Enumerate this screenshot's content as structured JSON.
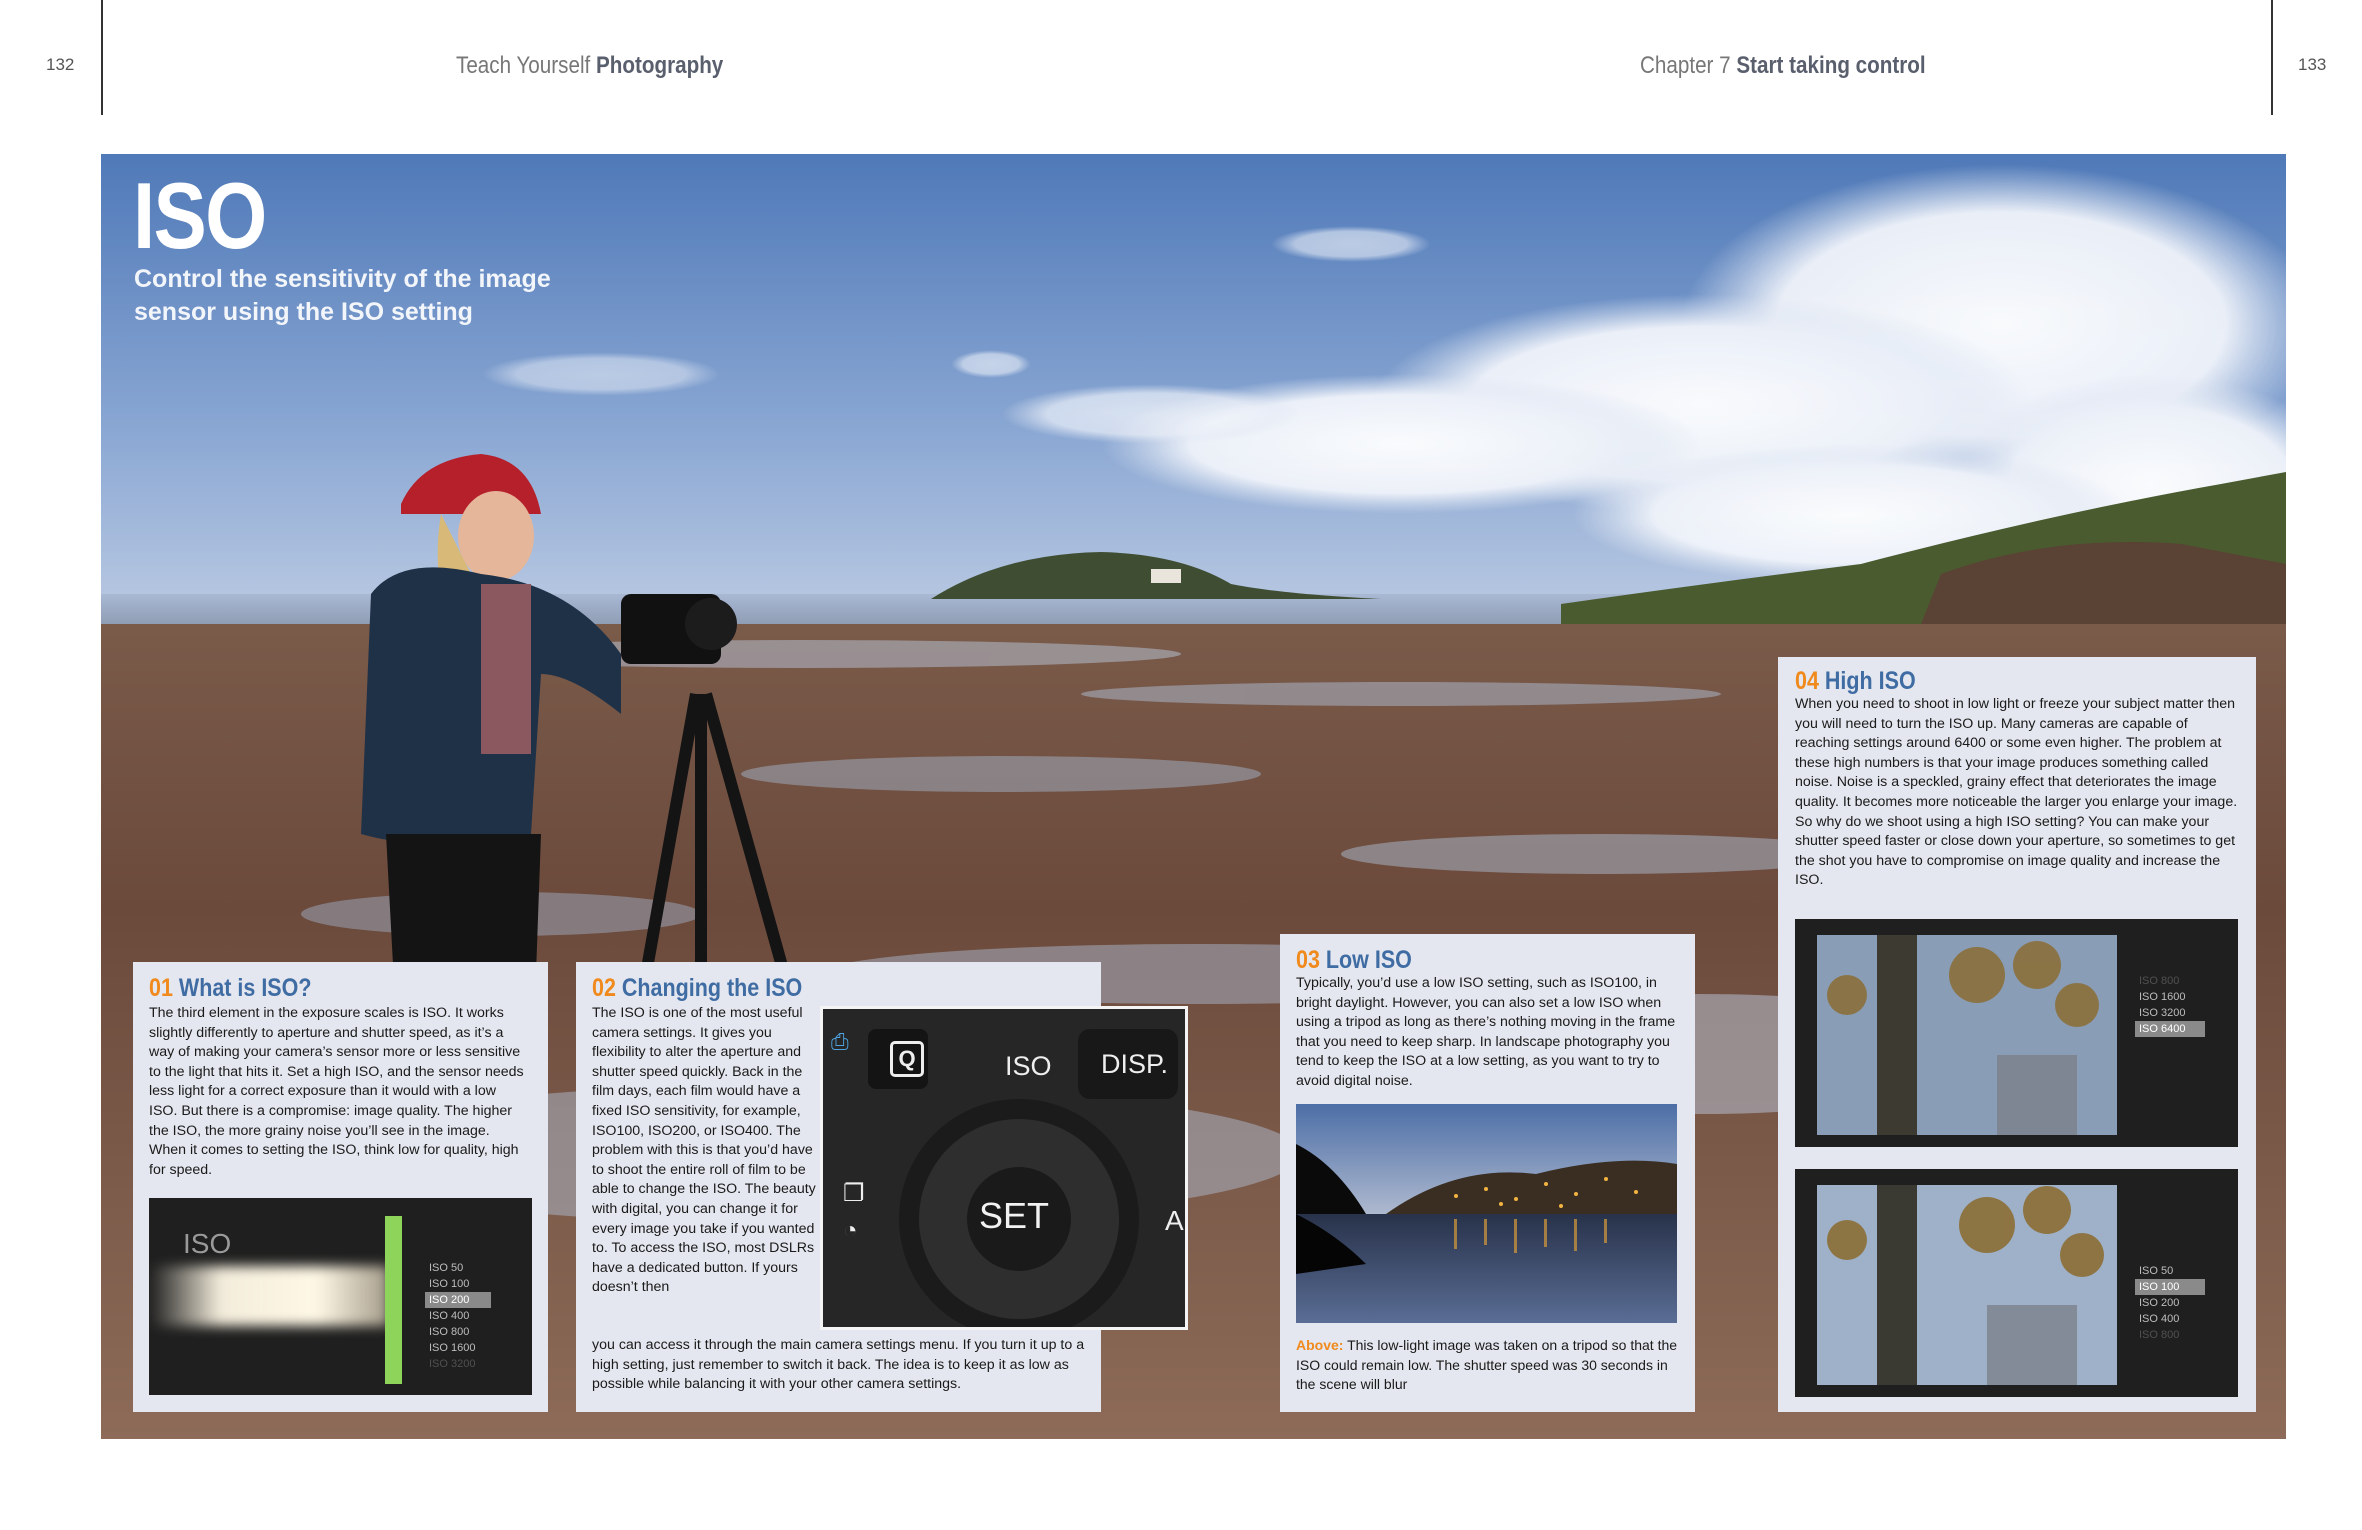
{
  "header": {
    "left_page_number": "132",
    "left_running_light": "Teach Yourself",
    "left_running_bold": "Photography",
    "right_running_light": "Chapter 7",
    "right_running_bold": "Start taking control",
    "right_page_number": "133"
  },
  "hero": {
    "title": "ISO",
    "subtitle": "Control the sensitivity of the image sensor using the ISO setting"
  },
  "sections": [
    {
      "number": "01",
      "heading": "What is ISO?",
      "body": "The third element in the exposure scales is ISO. It works slightly differently to aperture and shutter speed, as it’s a way of making your camera’s sensor more or less sensitive to the light that hits it. Set a high ISO, and the sensor needs less light for a correct exposure than it would with a low ISO. But there is a compromise: image quality. The higher the ISO, the more grainy noise you’ll see in the image. When it comes to setting the ISO, think low for quality, high for speed.",
      "image": {
        "label": "ISO",
        "iso_values": [
          "ISO 50",
          "ISO 100",
          "ISO 200",
          "ISO 400",
          "ISO 800",
          "ISO 1600",
          "ISO 3200"
        ],
        "selected": "ISO 200"
      }
    },
    {
      "number": "02",
      "heading": "Changing the ISO",
      "body_narrow": "The ISO is one of the most useful camera settings. It gives you flexibility to alter the aperture and shutter speed quickly. Back in the film days, each film would have a fixed ISO sensitivity, for example, ISO100, ISO200, or ISO400. The problem with this is that you’d have to shoot the entire roll of film to be able to change the ISO. The beauty with digital, you can change it for every image you take if you wanted to. To access the ISO, most DSLRs have a dedicated button. If yours doesn’t then",
      "body_wide": "you can access it through the main camera settings menu. If you turn it up to a high setting, just remember to switch it back. The idea is to keep it as low as possible while balancing it with your other camera settings.",
      "camera_labels": {
        "q": "Q",
        "iso": "ISO",
        "disp": "DISP.",
        "set": "SET",
        "a": "A"
      }
    },
    {
      "number": "03",
      "heading": "Low ISO",
      "body": "Typically, you’d use a low ISO setting, such as ISO100, in bright daylight. However, you can also set a low ISO when using a tripod as long as there’s nothing moving in the frame that you need to keep sharp. In landscape photography you tend to keep the ISO at a low setting, as you want to try to avoid digital noise.",
      "caption_label": "Above:",
      "caption": "This low-light image was taken on a tripod so that the ISO could remain low. The shutter speed was 30 seconds in the scene will blur"
    },
    {
      "number": "04",
      "heading": "High ISO",
      "body": "When you need to shoot in low light or freeze your subject matter then you will need to turn the ISO up. Many cameras are capable of reaching settings around 6400 or some even higher. The problem at these high numbers is that your image produces something called noise. Noise is a speckled, grainy effect that deteriorates the image quality. It becomes more noticeable the larger you enlarge your image. So why do we shoot using a high ISO setting? You can make your shutter speed faster or close down your aperture, so sometimes to get the shot you have to compromise on image quality and increase the ISO.",
      "image_top": {
        "iso_values": [
          "ISO 800",
          "ISO 1600",
          "ISO 3200",
          "ISO 6400"
        ],
        "selected": "ISO 6400"
      },
      "image_bottom": {
        "iso_values": [
          "ISO 50",
          "ISO 100",
          "ISO 200",
          "ISO 400",
          "ISO 800"
        ],
        "selected": "ISO 100"
      }
    }
  ]
}
